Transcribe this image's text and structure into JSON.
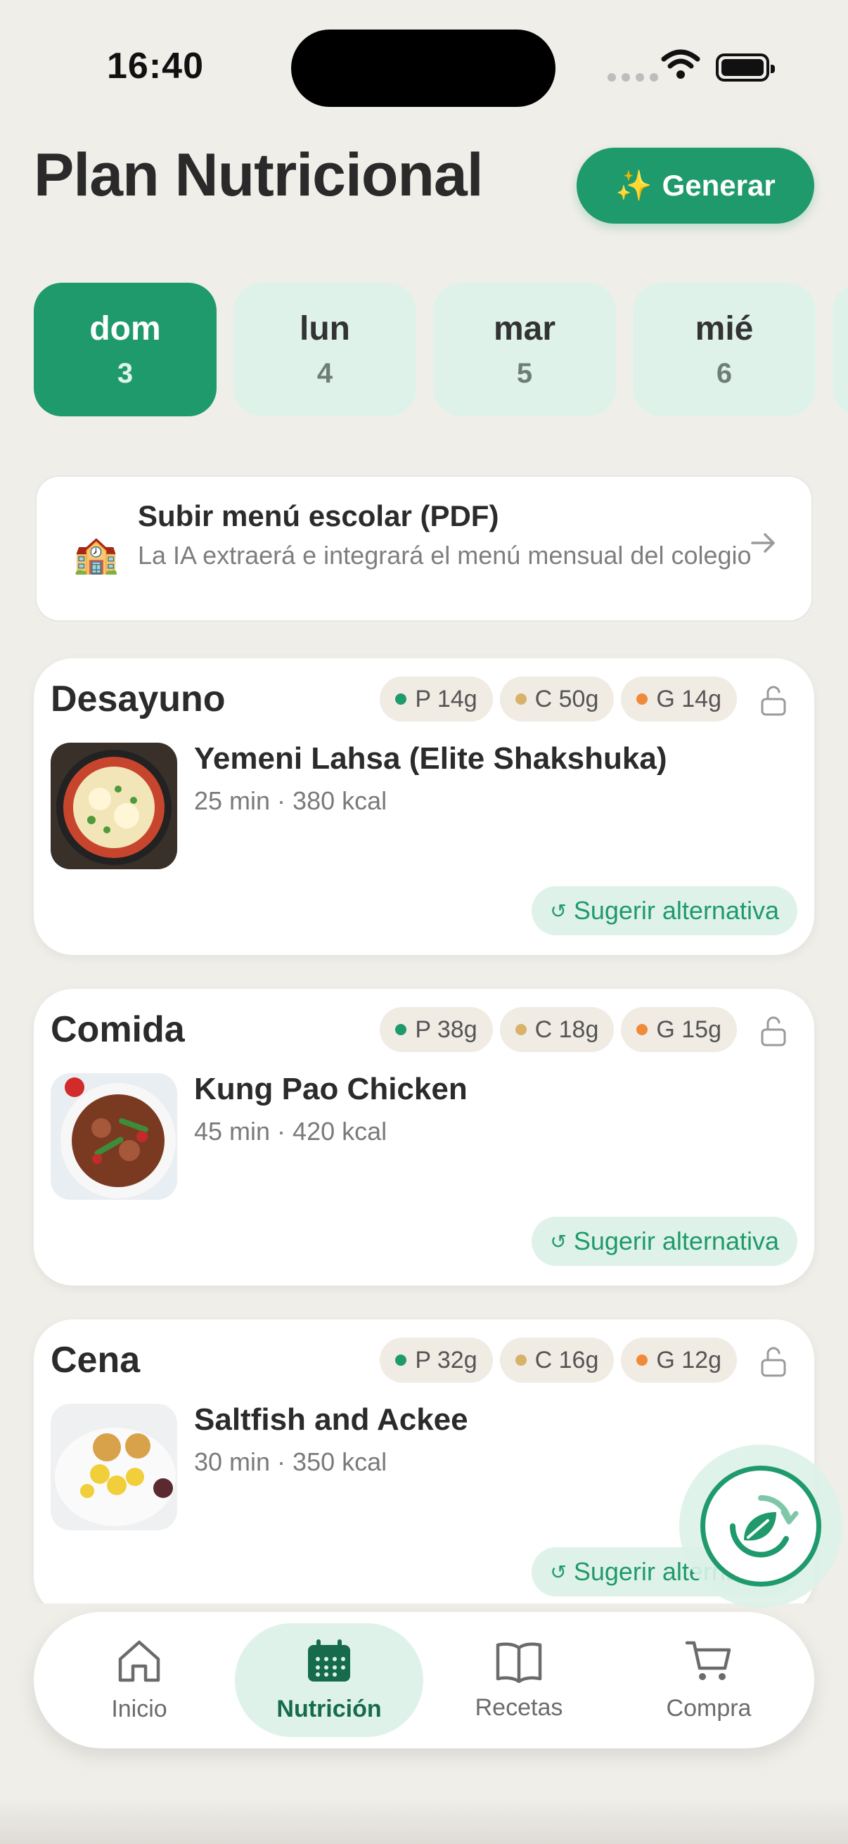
{
  "status_bar": {
    "time": "16:40"
  },
  "header": {
    "title": "Plan Nutricional",
    "generate_icon": "✨",
    "generate_label": "Generar"
  },
  "days": [
    {
      "name": "dom",
      "num": "3",
      "active": true
    },
    {
      "name": "lun",
      "num": "4"
    },
    {
      "name": "mar",
      "num": "5"
    },
    {
      "name": "mié",
      "num": "6"
    }
  ],
  "upload": {
    "icon": "🏫",
    "title": "Subir menú escolar (PDF)",
    "subtitle": "La IA extraerá e integrará el menú mensual del colegio"
  },
  "meals": [
    {
      "name": "Desayuno",
      "protein": "P 14g",
      "carbs": "C 50g",
      "fat": "G 14g",
      "dish": "Yemeni Lahsa (Elite Shakshuka)",
      "meta": "25 min · 380 kcal",
      "alt_icon": "↺",
      "alt_label": "Sugerir alternativa"
    },
    {
      "name": "Comida",
      "protein": "P 38g",
      "carbs": "C 18g",
      "fat": "G 15g",
      "dish": "Kung Pao Chicken",
      "meta": "45 min · 420 kcal",
      "alt_icon": "↺",
      "alt_label": "Sugerir alternativa"
    },
    {
      "name": "Cena",
      "protein": "P 32g",
      "carbs": "C 16g",
      "fat": "G 12g",
      "dish": "Saltfish and Ackee",
      "meta": "30 min · 350 kcal",
      "alt_icon": "↺",
      "alt_label": "Sugerir alternativa"
    }
  ],
  "nav": [
    {
      "label": "Inicio",
      "icon": "home-icon"
    },
    {
      "label": "Nutrición",
      "icon": "calendar-icon",
      "active": true
    },
    {
      "label": "Recetas",
      "icon": "book-icon"
    },
    {
      "label": "Compra",
      "icon": "cart-icon"
    }
  ],
  "colors": {
    "accent": "#1f9a6c",
    "accent_light": "#dff2ea",
    "protein": "#1f9a6c",
    "carbs": "#d8b26a",
    "fat": "#ef8a3a"
  }
}
